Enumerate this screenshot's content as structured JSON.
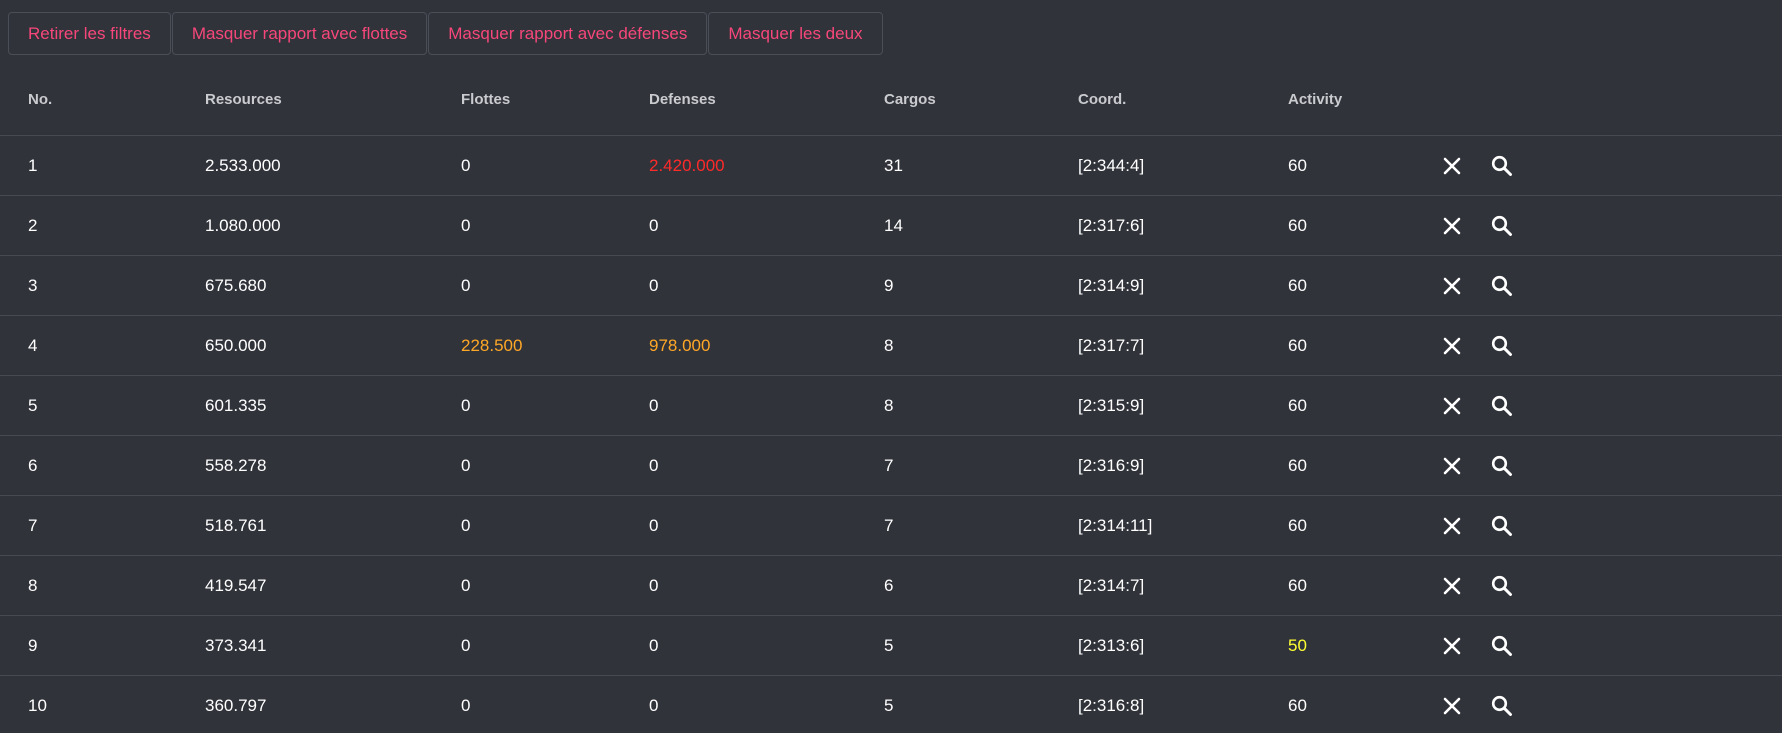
{
  "filters": [
    {
      "label": "Retirer les filtres",
      "name": "remove-filters-button"
    },
    {
      "label": "Masquer rapport avec flottes",
      "name": "hide-fleet-reports-button"
    },
    {
      "label": "Masquer rapport avec défenses",
      "name": "hide-defense-reports-button"
    },
    {
      "label": "Masquer les deux",
      "name": "hide-both-button"
    }
  ],
  "colors": {
    "background": "#30333a",
    "accent": "#f7477a",
    "text": "#ffffff",
    "danger": "#ff2a2a",
    "warning": "#ffa726",
    "highlight": "#ffff33"
  },
  "table": {
    "columns": [
      "No.",
      "Resources",
      "Flottes",
      "Defenses",
      "Cargos",
      "Coord.",
      "Activity"
    ],
    "rows": [
      {
        "no": "1",
        "resources": "2.533.000",
        "flottes": "0",
        "defenses": "2.420.000",
        "defenses_status": "danger",
        "cargos": "31",
        "coord": "[2:344:4]",
        "activity": "60"
      },
      {
        "no": "2",
        "resources": "1.080.000",
        "flottes": "0",
        "defenses": "0",
        "cargos": "14",
        "coord": "[2:317:6]",
        "activity": "60"
      },
      {
        "no": "3",
        "resources": "675.680",
        "flottes": "0",
        "defenses": "0",
        "cargos": "9",
        "coord": "[2:314:9]",
        "activity": "60"
      },
      {
        "no": "4",
        "resources": "650.000",
        "flottes": "228.500",
        "flottes_status": "warning",
        "defenses": "978.000",
        "defenses_status": "warning",
        "cargos": "8",
        "coord": "[2:317:7]",
        "activity": "60"
      },
      {
        "no": "5",
        "resources": "601.335",
        "flottes": "0",
        "defenses": "0",
        "cargos": "8",
        "coord": "[2:315:9]",
        "activity": "60"
      },
      {
        "no": "6",
        "resources": "558.278",
        "flottes": "0",
        "defenses": "0",
        "cargos": "7",
        "coord": "[2:316:9]",
        "activity": "60"
      },
      {
        "no": "7",
        "resources": "518.761",
        "flottes": "0",
        "defenses": "0",
        "cargos": "7",
        "coord": "[2:314:11]",
        "activity": "60"
      },
      {
        "no": "8",
        "resources": "419.547",
        "flottes": "0",
        "defenses": "0",
        "cargos": "6",
        "coord": "[2:314:7]",
        "activity": "60"
      },
      {
        "no": "9",
        "resources": "373.341",
        "flottes": "0",
        "defenses": "0",
        "cargos": "5",
        "coord": "[2:313:6]",
        "activity": "50",
        "activity_status": "highlight"
      },
      {
        "no": "10",
        "resources": "360.797",
        "flottes": "0",
        "defenses": "0",
        "cargos": "5",
        "coord": "[2:316:8]",
        "activity": "60"
      }
    ],
    "row_actions": [
      {
        "icon": "close-icon",
        "name": "delete-report-button"
      },
      {
        "icon": "search-icon",
        "name": "view-report-button"
      }
    ]
  }
}
